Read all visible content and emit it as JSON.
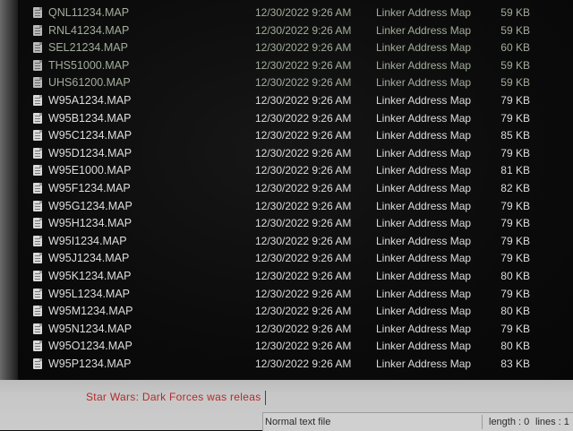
{
  "file_list": {
    "rows": [
      {
        "name": "QNL11234.MAP",
        "date": "12/30/2022 9:26 AM",
        "type": "Linker Address Map",
        "size": "59 KB"
      },
      {
        "name": "RNL41234.MAP",
        "date": "12/30/2022 9:26 AM",
        "type": "Linker Address Map",
        "size": "59 KB"
      },
      {
        "name": "SEL21234.MAP",
        "date": "12/30/2022 9:26 AM",
        "type": "Linker Address Map",
        "size": "60 KB"
      },
      {
        "name": "THS51000.MAP",
        "date": "12/30/2022 9:26 AM",
        "type": "Linker Address Map",
        "size": "59 KB"
      },
      {
        "name": "UHS61200.MAP",
        "date": "12/30/2022 9:26 AM",
        "type": "Linker Address Map",
        "size": "59 KB"
      },
      {
        "name": "W95A1234.MAP",
        "date": "12/30/2022 9:26 AM",
        "type": "Linker Address Map",
        "size": "79 KB"
      },
      {
        "name": "W95B1234.MAP",
        "date": "12/30/2022 9:26 AM",
        "type": "Linker Address Map",
        "size": "79 KB"
      },
      {
        "name": "W95C1234.MAP",
        "date": "12/30/2022 9:26 AM",
        "type": "Linker Address Map",
        "size": "85 KB"
      },
      {
        "name": "W95D1234.MAP",
        "date": "12/30/2022 9:26 AM",
        "type": "Linker Address Map",
        "size": "79 KB"
      },
      {
        "name": "W95E1000.MAP",
        "date": "12/30/2022 9:26 AM",
        "type": "Linker Address Map",
        "size": "81 KB"
      },
      {
        "name": "W95F1234.MAP",
        "date": "12/30/2022 9:26 AM",
        "type": "Linker Address Map",
        "size": "82 KB"
      },
      {
        "name": "W95G1234.MAP",
        "date": "12/30/2022 9:26 AM",
        "type": "Linker Address Map",
        "size": "79 KB"
      },
      {
        "name": "W95H1234.MAP",
        "date": "12/30/2022 9:26 AM",
        "type": "Linker Address Map",
        "size": "79 KB"
      },
      {
        "name": "W95I1234.MAP",
        "date": "12/30/2022 9:26 AM",
        "type": "Linker Address Map",
        "size": "79 KB"
      },
      {
        "name": "W95J1234.MAP",
        "date": "12/30/2022 9:26 AM",
        "type": "Linker Address Map",
        "size": "79 KB"
      },
      {
        "name": "W95K1234.MAP",
        "date": "12/30/2022 9:26 AM",
        "type": "Linker Address Map",
        "size": "80 KB"
      },
      {
        "name": "W95L1234.MAP",
        "date": "12/30/2022 9:26 AM",
        "type": "Linker Address Map",
        "size": "79 KB"
      },
      {
        "name": "W95M1234.MAP",
        "date": "12/30/2022 9:26 AM",
        "type": "Linker Address Map",
        "size": "80 KB"
      },
      {
        "name": "W95N1234.MAP",
        "date": "12/30/2022 9:26 AM",
        "type": "Linker Address Map",
        "size": "79 KB"
      },
      {
        "name": "W95O1234.MAP",
        "date": "12/30/2022 9:26 AM",
        "type": "Linker Address Map",
        "size": "80 KB"
      },
      {
        "name": "W95P1234.MAP",
        "date": "12/30/2022 9:26 AM",
        "type": "Linker Address Map",
        "size": "83 KB"
      }
    ]
  },
  "notepad": {
    "text": "Star Wars: Dark Forces was releas",
    "status": {
      "file_type": "Normal text file",
      "length": "length : 0",
      "lines": "lines : 1"
    }
  },
  "colors": {
    "list_background": "#0c0c0c",
    "list_text": "#dcdcdc",
    "editor_text": "#b52a2a",
    "statusbar_background": "#d0d0d0"
  },
  "icons": {
    "file_row": "document-file-icon"
  }
}
